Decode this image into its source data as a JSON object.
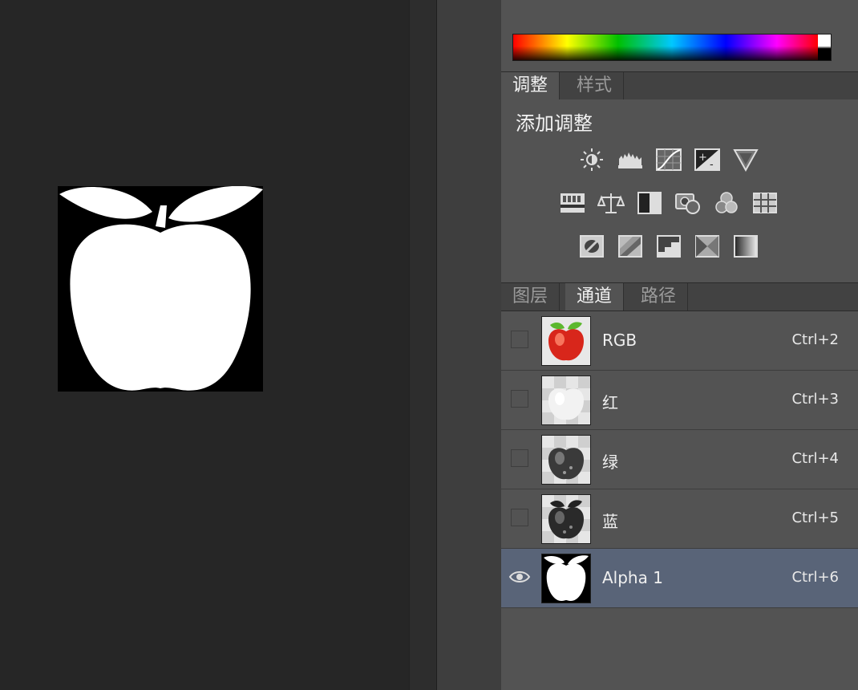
{
  "adjust_tabs": [
    "调整",
    "样式"
  ],
  "adjust_title": "添加调整",
  "adjust_icons": [
    [
      "brightness-contrast-icon",
      "levels-icon",
      "curves-icon",
      "exposure-icon",
      "vibrance-triangle-icon"
    ],
    [
      "hue-saturation-icon",
      "color-balance-icon",
      "black-white-icon",
      "photo-filter-icon",
      "channel-mixer-icon",
      "color-lookup-icon"
    ],
    [
      "invert-icon",
      "posterize-icon",
      "threshold-icon",
      "selective-color-icon",
      "gradient-map-icon"
    ]
  ],
  "layer_tabs": [
    "图层",
    "通道",
    "路径"
  ],
  "channels": [
    {
      "name": "RGB",
      "shortcut": "Ctrl+2",
      "visible": false,
      "selected": false
    },
    {
      "name": "红",
      "shortcut": "Ctrl+3",
      "visible": false,
      "selected": false
    },
    {
      "name": "绿",
      "shortcut": "Ctrl+4",
      "visible": false,
      "selected": false
    },
    {
      "name": "蓝",
      "shortcut": "Ctrl+5",
      "visible": false,
      "selected": false
    },
    {
      "name": "Alpha 1",
      "shortcut": "Ctrl+6",
      "visible": true,
      "selected": true
    }
  ],
  "colors": {
    "panel_bg": "#535353",
    "selected_row": "#596478",
    "canvas_bg": "#262626"
  }
}
